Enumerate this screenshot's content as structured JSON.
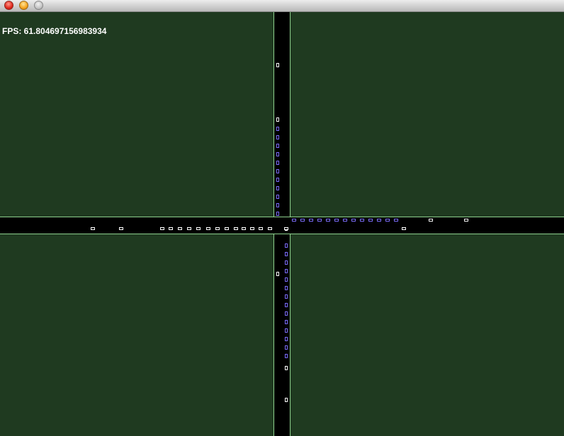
{
  "window": {
    "controls": [
      {
        "name": "close-button",
        "icon": "red-traffic-light-button"
      },
      {
        "name": "minimize-button",
        "icon": "yellow-traffic-light-button"
      },
      {
        "name": "zoom-button",
        "icon": "gray-traffic-light-button"
      }
    ]
  },
  "hud": {
    "fps_text": "FPS: 61.804697156983934"
  },
  "colors": {
    "grass": "#1f3a20",
    "road": "#000000",
    "road_edge": "#8fd28f",
    "car_moving": "#ffffff",
    "car_waiting": "#7b6cff"
  },
  "traffic": {
    "northbound_lane_left": {
      "moving": 2,
      "waiting": 11
    },
    "southbound_lane_right": {
      "moving": 3,
      "waiting": 14
    },
    "eastbound_lane_top": {
      "moving": 2,
      "waiting": 13
    },
    "westbound_lane_bottom": {
      "moving": 15,
      "waiting": 0
    }
  }
}
